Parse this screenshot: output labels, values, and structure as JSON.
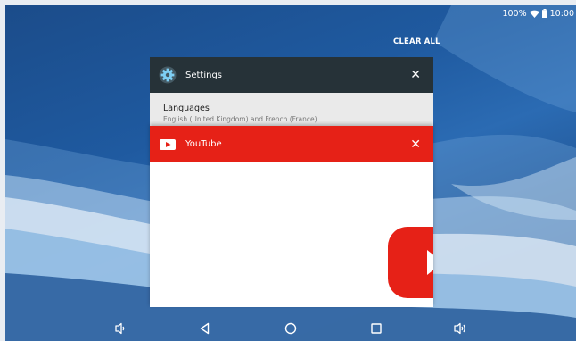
{
  "status_bar": {
    "battery": "100%",
    "time": "10:00",
    "icons": [
      "wifi-icon",
      "battery-icon"
    ]
  },
  "recents": {
    "clear_all_label": "CLEAR ALL",
    "cards": [
      {
        "app_name": "Settings",
        "icon": "settings-gear-icon",
        "header_color": "#263238",
        "preview": {
          "title": "Languages",
          "subtitle": "English (United Kingdom) and French (France)"
        }
      },
      {
        "app_name": "YouTube",
        "icon": "youtube-play-icon",
        "header_color": "#e62117"
      }
    ]
  },
  "nav_bar": {
    "buttons": [
      "volume-down-icon",
      "back-icon",
      "home-icon",
      "recents-icon",
      "volume-up-icon"
    ]
  }
}
